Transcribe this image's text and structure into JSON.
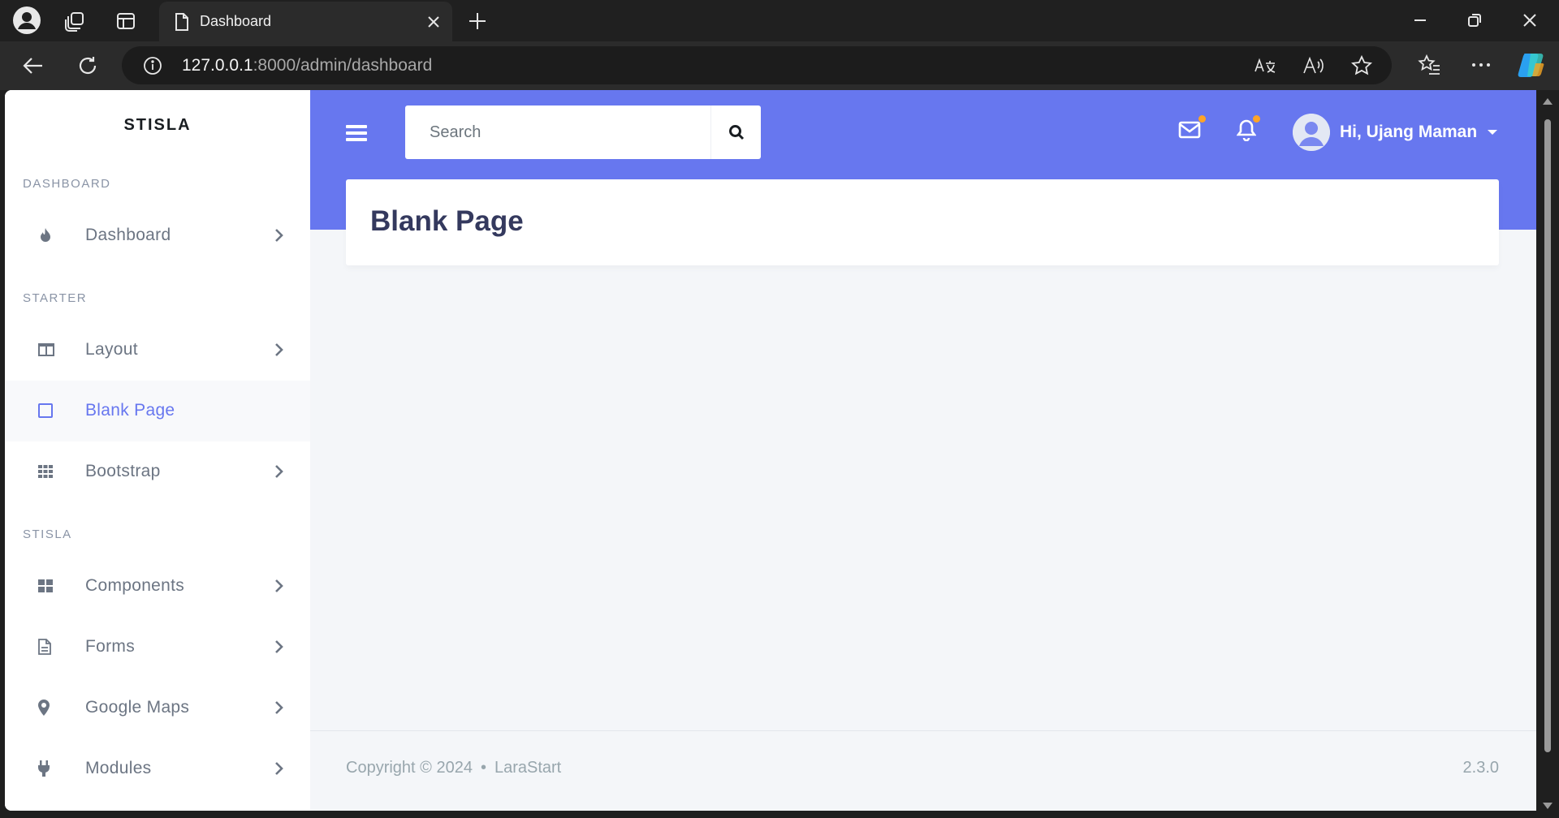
{
  "browser": {
    "tab_title": "Dashboard",
    "url_host": "127.0.0.1",
    "url_rest": ":8000/admin/dashboard"
  },
  "sidebar": {
    "brand": "STISLA",
    "sections": [
      {
        "header": "DASHBOARD"
      },
      {
        "header": "STARTER"
      },
      {
        "header": "STISLA"
      }
    ],
    "items": [
      {
        "label": "Dashboard",
        "icon": "fire-icon",
        "has_submenu": true,
        "active": false
      },
      {
        "label": "Layout",
        "icon": "columns-icon",
        "has_submenu": true,
        "active": false
      },
      {
        "label": "Blank Page",
        "icon": "square-icon",
        "has_submenu": false,
        "active": true
      },
      {
        "label": "Bootstrap",
        "icon": "th-icon",
        "has_submenu": true,
        "active": false
      },
      {
        "label": "Components",
        "icon": "th-large-icon",
        "has_submenu": true,
        "active": false
      },
      {
        "label": "Forms",
        "icon": "file-alt-icon",
        "has_submenu": true,
        "active": false
      },
      {
        "label": "Google Maps",
        "icon": "map-marker-icon",
        "has_submenu": true,
        "active": false
      },
      {
        "label": "Modules",
        "icon": "plug-icon",
        "has_submenu": true,
        "active": false
      }
    ]
  },
  "navbar": {
    "search_placeholder": "Search",
    "user_greeting": "Hi, Ujang Maman"
  },
  "main": {
    "page_title": "Blank Page"
  },
  "footer": {
    "copyright": "Copyright © 2024",
    "separator": "•",
    "brand": "LaraStart",
    "version": "2.3.0"
  },
  "colors": {
    "primary": "#6777ef",
    "notification_dot": "#ffa426",
    "title": "#34395e",
    "muted": "#98a6ad"
  }
}
